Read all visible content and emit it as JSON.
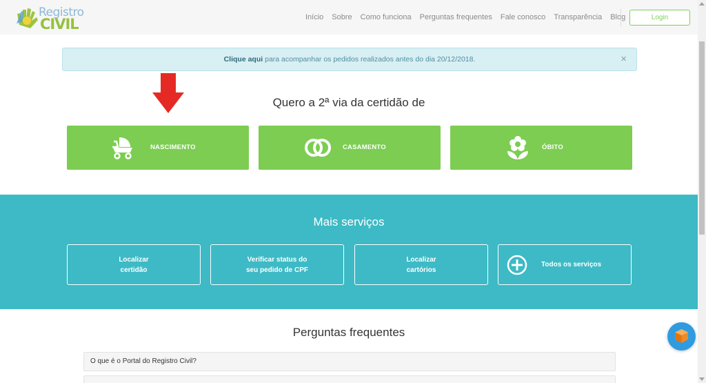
{
  "logo": {
    "line1": "Registro",
    "line2": "CIVIL"
  },
  "nav": {
    "items": [
      "Início",
      "Sobre",
      "Como funciona",
      "Perguntas frequentes",
      "Fale conosco",
      "Transparência",
      "Blog"
    ],
    "login_label": "Login"
  },
  "alert": {
    "link_text": "Clique aqui",
    "message": " para acompanhar os pedidos realizados antes do dia 20/12/2018.",
    "close_symbol": "×"
  },
  "certidao": {
    "title": "Quero a 2ª via da certidão de",
    "buttons": [
      {
        "label": "NASCIMENTO",
        "icon": "baby-stroller-icon"
      },
      {
        "label": "CASAMENTO",
        "icon": "wedding-rings-icon"
      },
      {
        "label": "ÓBITO",
        "icon": "flower-icon"
      }
    ]
  },
  "mais_servicos": {
    "title": "Mais serviços",
    "items": [
      {
        "label": "Localizar\ncertidão"
      },
      {
        "label": "Verificar status do\nseu pedido de CPF"
      },
      {
        "label": "Localizar\ncartórios"
      },
      {
        "label": "Todos os serviços",
        "icon": "plus-circle-icon"
      }
    ]
  },
  "faq": {
    "title": "Perguntas frequentes",
    "items": [
      "O que é o Portal do Registro Civil?"
    ]
  },
  "colors": {
    "green": "#7ccd52",
    "teal": "#3dbac5",
    "arrow": "#e52a25",
    "chat": "#2f9be0"
  }
}
